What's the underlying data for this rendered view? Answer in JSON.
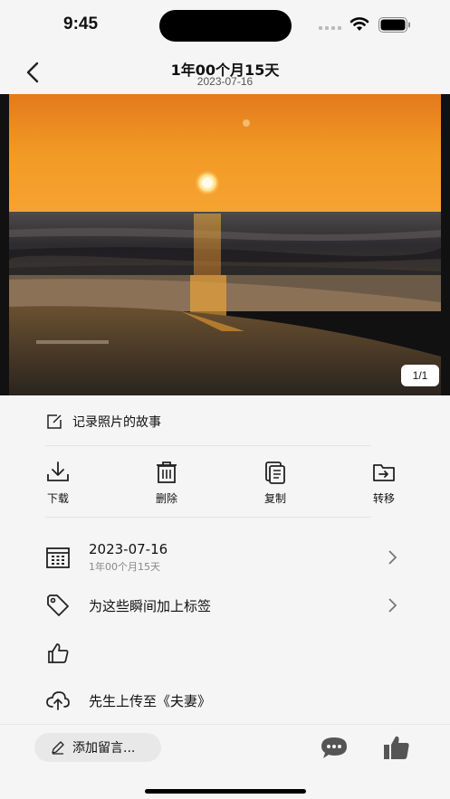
{
  "status": {
    "time": "9:45"
  },
  "nav": {
    "title": "1年00个月15天",
    "subtitle": "2023-07-16"
  },
  "photo": {
    "counter": "1/1"
  },
  "story": {
    "label": "记录照片的故事"
  },
  "actions": [
    {
      "label": "下载",
      "icon": "download-icon"
    },
    {
      "label": "删除",
      "icon": "trash-icon"
    },
    {
      "label": "复制",
      "icon": "copy-icon"
    },
    {
      "label": "转移",
      "icon": "move-folder-icon"
    }
  ],
  "date_row": {
    "main": "2023-07-16",
    "sub": "1年00个月15天"
  },
  "tag_row": {
    "main": "为这些瞬间加上标签"
  },
  "upload_row": {
    "main": "先生上传至《夫妻》"
  },
  "bottom": {
    "comment_placeholder": "添加留言..."
  }
}
